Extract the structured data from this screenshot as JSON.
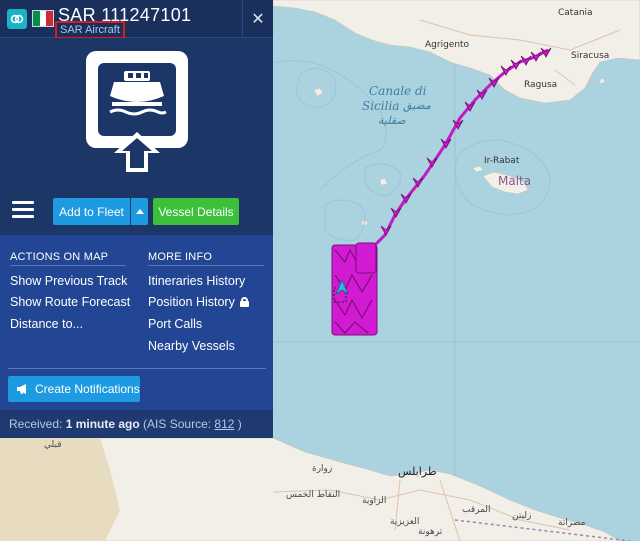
{
  "vessel": {
    "name": "SAR 111247101",
    "type": "SAR Aircraft",
    "flag_colors": [
      "#009246",
      "#ffffff",
      "#ce2b37"
    ]
  },
  "toolbar": {
    "menu_icon": "hamburger-menu-icon",
    "add_to_fleet_label": "Add to Fleet",
    "vessel_details_label": "Vessel Details"
  },
  "actions_on_map": {
    "heading": "ACTIONS ON MAP",
    "items": [
      "Show Previous Track",
      "Show Route Forecast",
      "Distance to..."
    ]
  },
  "more_info": {
    "heading": "MORE INFO",
    "items": [
      "Itineraries History",
      "Position History",
      "Port Calls",
      "Nearby Vessels"
    ]
  },
  "notifications": {
    "label": "Create Notifications"
  },
  "received": {
    "prefix": "Received: ",
    "age": "1 minute ago",
    "source_prefix": " (AIS Source: ",
    "source_id": "812",
    "source_suffix": " )"
  },
  "map": {
    "places": {
      "catania": "Catania",
      "agrigento": "Agrigento",
      "siracusa": "Siracusa",
      "ragusa": "Ragusa",
      "ir_rabat": "Ir-Rabat",
      "malta": "Malta",
      "canale_line1": "Canale di",
      "canale_line2": "Sicilia",
      "canale_ar1": "مضيق",
      "canale_ar2": "صقلية",
      "tripoli_ar": "طرابلس",
      "zawiya_ar": "الزاوية",
      "zuwara_ar": "زوارة",
      "khams_ar": "الخمس",
      "aziziya_ar": "العزيزية",
      "marqab_ar": "المرقب",
      "tarhuna_ar": "ترهونة",
      "zliten_ar": "زليتن",
      "misrata_ar": "مصراتة",
      "qabali_ar": "قبلي",
      "nafat_ar": "النقاط الخمس"
    },
    "colors": {
      "sea": "#aad3df",
      "land": "#f2efe9",
      "track": "#e01ee0",
      "track_outline": "#8a0f8a"
    }
  }
}
